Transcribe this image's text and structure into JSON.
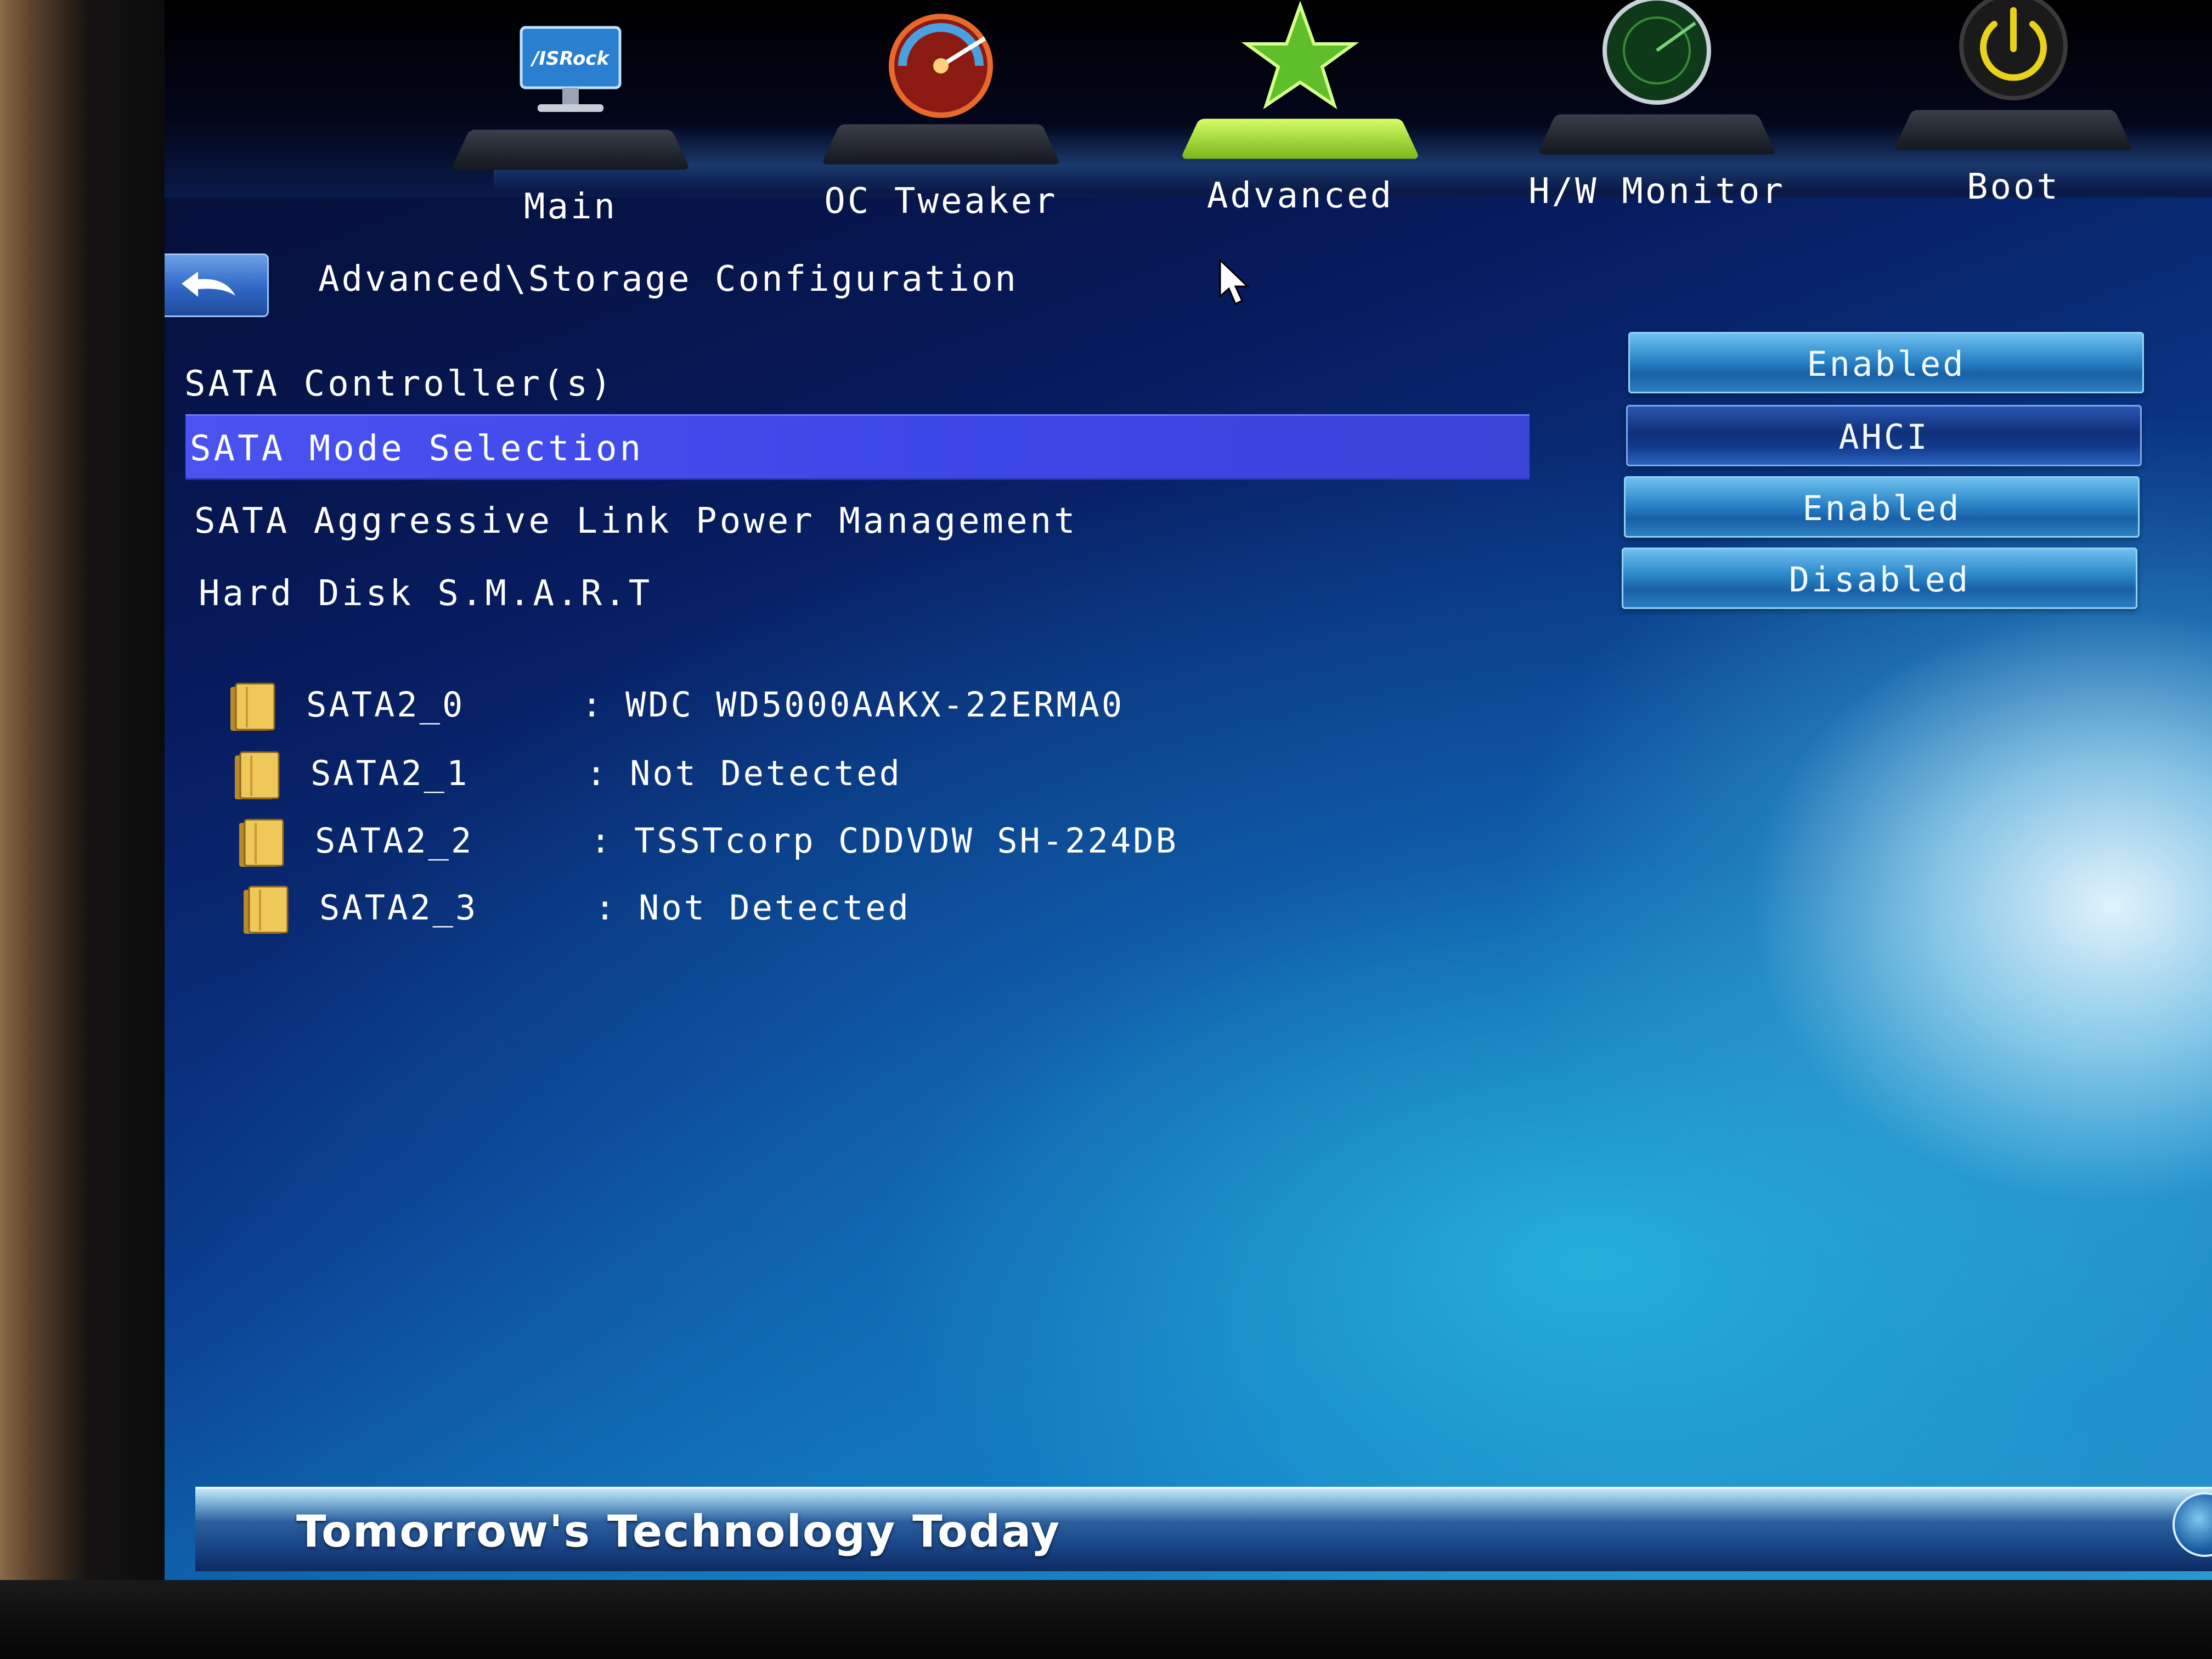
{
  "nav": {
    "tabs": [
      {
        "label": "Main",
        "icon": "asrock-monitor-icon",
        "icon_text": "/ISRock"
      },
      {
        "label": "OC Tweaker",
        "icon": "speedometer-icon"
      },
      {
        "label": "Advanced",
        "icon": "star-icon"
      },
      {
        "label": "H/W Monitor",
        "icon": "radar-icon"
      },
      {
        "label": "Boot",
        "icon": "power-icon"
      }
    ],
    "active_tab": "Advanced"
  },
  "breadcrumb": "Advanced\\Storage Configuration",
  "settings": [
    {
      "label": "SATA Controller(s)",
      "value": "Enabled"
    },
    {
      "label": "SATA Mode Selection",
      "value": "AHCI",
      "selected": true
    },
    {
      "label": "SATA Aggressive Link Power Management",
      "value": "Enabled"
    },
    {
      "label": "Hard Disk S.M.A.R.T",
      "value": "Disabled"
    }
  ],
  "drives": [
    {
      "port": "SATA2_0",
      "separator": ":",
      "model": "WDC WD5000AAKX-22ERMA0"
    },
    {
      "port": "SATA2_1",
      "separator": ":",
      "model": "Not Detected"
    },
    {
      "port": "SATA2_2",
      "separator": ":",
      "model": "TSSTcorp CDDVDW SH-224DB"
    },
    {
      "port": "SATA2_3",
      "separator": ":",
      "model": "Not Detected"
    }
  ],
  "footer": {
    "slogan": "Tomorrow's Technology Today"
  },
  "colors": {
    "selection": "#3b46e6",
    "value_button": "#2b86c8",
    "value_button_active": "#0f2f7a",
    "background_deep": "#071a5c",
    "background_light": "#3ab2de"
  }
}
